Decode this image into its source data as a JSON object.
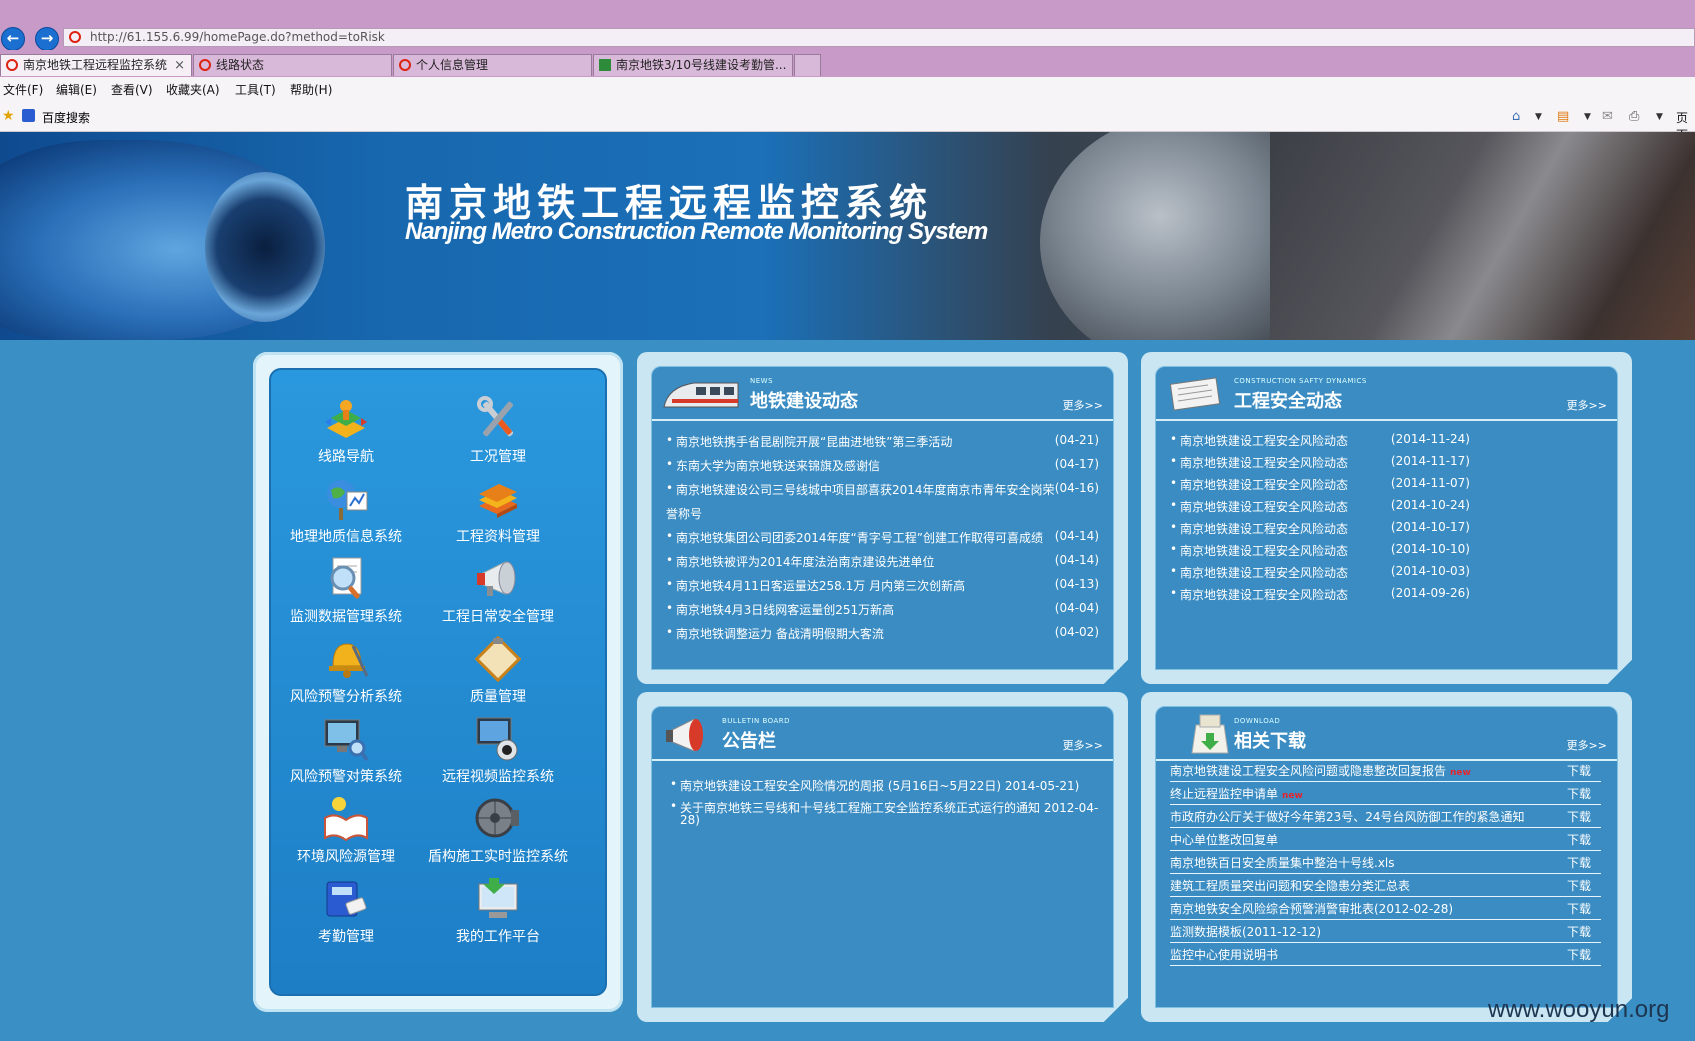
{
  "browser": {
    "url": "http://61.155.6.99/homePage.do?method=toRisk",
    "tabs": [
      {
        "label": "南京地铁工程远程监控系统",
        "close": "×"
      },
      {
        "label": "线路状态"
      },
      {
        "label": "个人信息管理"
      },
      {
        "label": "南京地铁3/10号线建设考勤管..."
      }
    ],
    "menu": [
      "文件(F)",
      "编辑(E)",
      "查看(V)",
      "收藏夹(A)",
      "工具(T)",
      "帮助(H)"
    ],
    "favorites": [
      "百度搜索"
    ],
    "toolbar_right": "页面"
  },
  "banner": {
    "title_cn": "南京地铁工程远程监控系统",
    "title_en": "Nanjing Metro Construction Remote Monitoring System"
  },
  "nav": {
    "items": [
      {
        "label": "线路导航",
        "icon": "route-navigation-icon"
      },
      {
        "label": "工况管理",
        "icon": "tools-icon"
      },
      {
        "label": "地理地质信息系统",
        "icon": "globe-icon"
      },
      {
        "label": "工程资料管理",
        "icon": "books-icon"
      },
      {
        "label": "监测数据管理系统",
        "icon": "magnifier-document-icon"
      },
      {
        "label": "工程日常安全管理",
        "icon": "megaphone-icon"
      },
      {
        "label": "风险预警分析系统",
        "icon": "alarm-bell-icon"
      },
      {
        "label": "质量管理",
        "icon": "clipboard-icon"
      },
      {
        "label": "风险预警对策系统",
        "icon": "monitor-magnifier-icon"
      },
      {
        "label": "远程视频监控系统",
        "icon": "camera-icon"
      },
      {
        "label": "环境风险源管理",
        "icon": "book-lightbulb-icon"
      },
      {
        "label": "盾构施工实时监控系统",
        "icon": "shield-machine-icon"
      },
      {
        "label": "考勤管理",
        "icon": "card-reader-icon"
      },
      {
        "label": "我的工作平台",
        "icon": "computer-icon"
      }
    ]
  },
  "news": {
    "en": "NEWS",
    "title": "地铁建设动态",
    "more": "更多>>",
    "items": [
      {
        "title": "南京地铁携手省昆剧院开展“昆曲进地铁”第三季活动",
        "date": "(04-21)"
      },
      {
        "title": "东南大学为南京地铁送来锦旗及感谢信",
        "date": "(04-17)"
      },
      {
        "title": "南京地铁建设公司三号线城中项目部喜获2014年度南京市青年安全岗荣",
        "title2": "誉称号",
        "date": "(04-16)"
      },
      {
        "title": "南京地铁集团公司团委2014年度“青字号工程”创建工作取得可喜成绩",
        "date": "(04-14)"
      },
      {
        "title": "南京地铁被评为2014年度法治南京建设先进单位",
        "date": "(04-14)"
      },
      {
        "title": "南京地铁4月11日客运量达258.1万 月内第三次创新高",
        "date": "(04-13)"
      },
      {
        "title": "南京地铁4月3日线网客运量创251万新高",
        "date": "(04-04)"
      },
      {
        "title": "南京地铁调整运力 备战清明假期大客流",
        "date": "(04-02)"
      }
    ]
  },
  "safety": {
    "en": "CONSTRUCTION SAFTY DYNAMICS",
    "title": "工程安全动态",
    "more": "更多>>",
    "items": [
      {
        "title": "南京地铁建设工程安全风险动态",
        "date": "(2014-11-24)"
      },
      {
        "title": "南京地铁建设工程安全风险动态",
        "date": "(2014-11-17)"
      },
      {
        "title": "南京地铁建设工程安全风险动态",
        "date": "(2014-11-07)"
      },
      {
        "title": "南京地铁建设工程安全风险动态",
        "date": "(2014-10-24)"
      },
      {
        "title": "南京地铁建设工程安全风险动态",
        "date": "(2014-10-17)"
      },
      {
        "title": "南京地铁建设工程安全风险动态",
        "date": "(2014-10-10)"
      },
      {
        "title": "南京地铁建设工程安全风险动态",
        "date": "(2014-10-03)"
      },
      {
        "title": "南京地铁建设工程安全风险动态",
        "date": "(2014-09-26)"
      }
    ]
  },
  "bulletin": {
    "en": "BULLETIN BOARD",
    "title": "公告栏",
    "more": "更多>>",
    "items": [
      {
        "title": "南京地铁建设工程安全风险情况的周报 (5月16日~5月22日) 2014-05-21)"
      },
      {
        "title": "关于南京地铁三号线和十号线工程施工安全监控系统正式运行的通知  2012-04-",
        "title2": "28)"
      }
    ]
  },
  "download": {
    "en": "DOWNLOAD",
    "title": "相关下载",
    "more": "更多>>",
    "download_label": "下载",
    "new_label": "new",
    "items": [
      {
        "title": "南京地铁建设工程安全风险问题或隐患整改回复报告",
        "is_new": true
      },
      {
        "title": "终止远程监控申请单",
        "is_new": true
      },
      {
        "title": "市政府办公厅关于做好今年第23号、24号台风防御工作的紧急通知",
        "is_new": false
      },
      {
        "title": "中心单位整改回复单",
        "is_new": false
      },
      {
        "title": "南京地铁百日安全质量集中整治十号线.xls",
        "is_new": false
      },
      {
        "title": "建筑工程质量突出问题和安全隐患分类汇总表",
        "is_new": false
      },
      {
        "title": "南京地铁安全风险综合预警消警审批表(2012-02-28)",
        "is_new": false
      },
      {
        "title": "监测数据模板(2011-12-12)",
        "is_new": false
      },
      {
        "title": "监控中心使用说明书",
        "is_new": false
      }
    ]
  },
  "watermark": "www.wooyun.org"
}
